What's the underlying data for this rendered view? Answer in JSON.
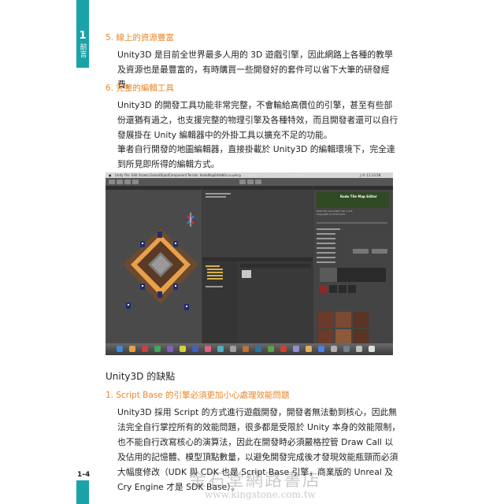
{
  "side_tab": {
    "chapter_number": "1",
    "chapter_label": "前言"
  },
  "page_number": "1-4",
  "sections": {
    "s5_heading": "5. 線上的資源豐富",
    "s5_para": "Unity3D 是目前全世界最多人用的 3D 遊戲引擎，因此網路上各種的教學及資源也是最豐富的，有時購買一些開發好的套件可以省下大筆的研發經費。",
    "s6_heading": "6. 完整的編輯工具",
    "s6_para1": "Unity3D 的開發工具功能非常完整，不會輸給高價位的引擎，甚至有些部份還猶有過之，也支援完整的物理引擎及各種特效，而且開發者還可以自行發展掛在 Unity 編輯器中的外掛工具以擴充不足的功能。",
    "s6_para2": "筆者自行開發的地圖編輯器，直接掛載於 Unity3D 的編輯環境下，完全達到所見即所得的編輯方式。",
    "cons_heading": "Unity3D 的缺點",
    "c1_heading": "1. Script Base 的引擎必須更加小心處理效能問題",
    "c1_para": "Unity3D 採用 Script 的方式進行遊戲開發，開發者無法動到核心，因此無法完全自行掌控所有的效能問題，很多都是受限於 Unity 本身的效能限制，也不能自行改寫核心的演算法，因此在開發時必須嚴格控管 Draw Call 以及佔用的記憶體、模型頂點數量，以避免開發完成後才發現效能瓶頸而必須大幅度修改（UDK 與 CDK 也是 Script Base 引擎，商業版的 Unreal 及 Cry Engine 才是 SDK Base）。"
  },
  "screenshot": {
    "menu_items": [
      "Unity",
      "File",
      "Edit",
      "Assets",
      "GameObject",
      "Component",
      "Terrain",
      "KodoMapEditor",
      "Window",
      "Help"
    ],
    "clock": "上午 11:13:58",
    "window_title": "Untitled - KodoTileMapEditor - PC, Mac & Linux Standalone",
    "inspector_title": "Kodo Tile Map Editor",
    "inspector_version": "Kodo tile map editor Ver. 1.0.4",
    "inspector_copyright": "Copyright (c) 2012 Kodo",
    "colors": {
      "panel": "#3b3b3b",
      "scene": "#4a4a4a",
      "menubar": "#d7d7d7"
    }
  },
  "watermark": {
    "line1": "金石堂網路書店",
    "line2": "www.kingstone.com.tw"
  }
}
